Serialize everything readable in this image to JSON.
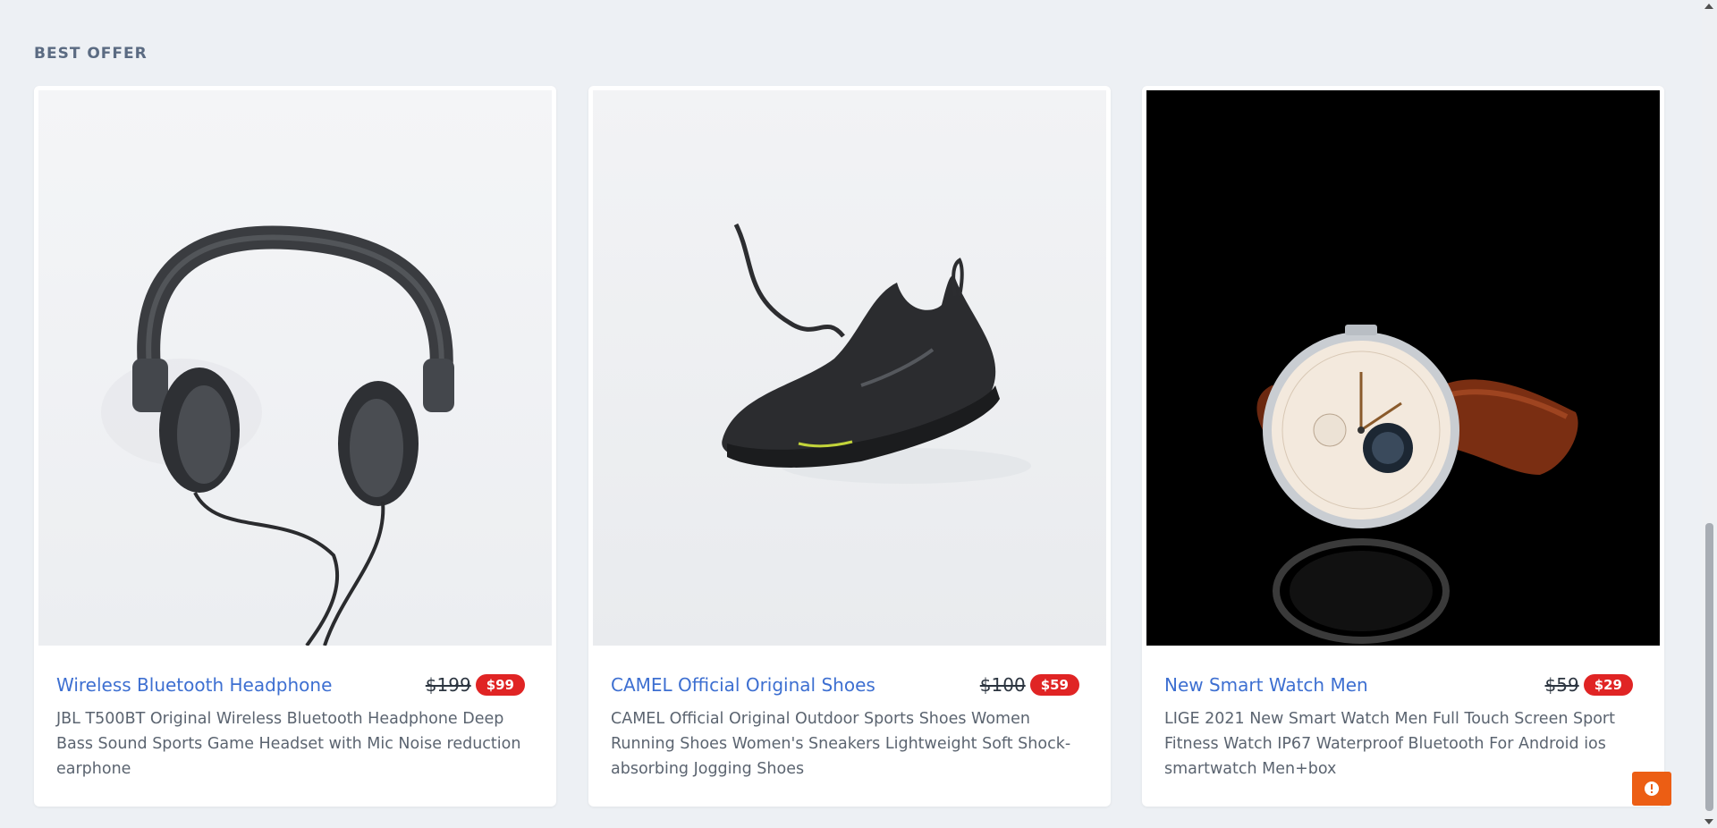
{
  "section": {
    "title": "BEST OFFER"
  },
  "products": [
    {
      "title": "Wireless Bluetooth Headphone",
      "old_price": "$199",
      "price": "$99",
      "description": "JBL T500BT Original Wireless Bluetooth Headphone Deep Bass Sound Sports Game Headset with Mic Noise reduction earphone",
      "image_icon": "headphone-image"
    },
    {
      "title": "CAMEL Official Original Shoes",
      "old_price": "$100",
      "price": "$59",
      "description": "CAMEL Official Original Outdoor Sports Shoes Women Running Shoes Women's Sneakers Lightweight Soft Shock-absorbing Jogging Shoes",
      "image_icon": "shoe-image"
    },
    {
      "title": "New Smart Watch Men",
      "old_price": "$59",
      "price": "$29",
      "description": "LIGE 2021 New Smart Watch Men Full Touch Screen Sport Fitness Watch IP67 Waterproof Bluetooth For Android ios smartwatch Men+box",
      "image_icon": "watch-image"
    }
  ],
  "feedback": {
    "icon": "exclamation-icon",
    "color": "#ec5e14"
  },
  "colors": {
    "title": "#3d6fd1",
    "sale_badge": "#e02424",
    "background": "#edf0f4"
  }
}
